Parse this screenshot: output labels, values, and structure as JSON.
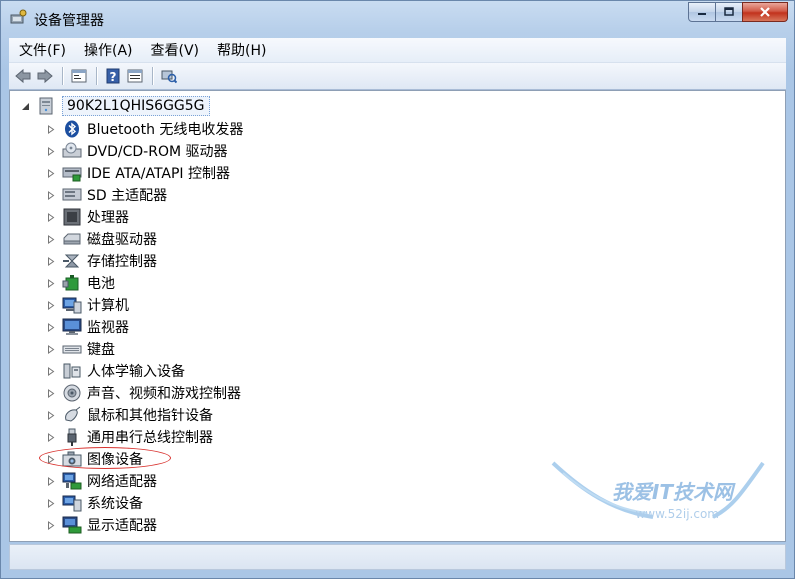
{
  "window": {
    "title": "设备管理器"
  },
  "menu": [
    "文件(F)",
    "操作(A)",
    "查看(V)",
    "帮助(H)"
  ],
  "toolbar": {
    "buttons": [
      "back-arrow-icon",
      "forward-arrow-icon",
      "properties-icon",
      "help-icon",
      "view-icon",
      "scan-hardware-icon"
    ]
  },
  "tree": {
    "root": "90K2L1QHIS6GG5G",
    "items": [
      {
        "label": "Bluetooth 无线电收发器",
        "icon": "bluetooth-icon"
      },
      {
        "label": "DVD/CD-ROM 驱动器",
        "icon": "dvd-drive-icon"
      },
      {
        "label": "IDE ATA/ATAPI 控制器",
        "icon": "ide-controller-icon"
      },
      {
        "label": "SD 主适配器",
        "icon": "sd-adapter-icon"
      },
      {
        "label": "处理器",
        "icon": "processor-icon"
      },
      {
        "label": "磁盘驱动器",
        "icon": "disk-drive-icon"
      },
      {
        "label": "存储控制器",
        "icon": "storage-controller-icon"
      },
      {
        "label": "电池",
        "icon": "battery-icon"
      },
      {
        "label": "计算机",
        "icon": "computer-icon"
      },
      {
        "label": "监视器",
        "icon": "monitor-icon"
      },
      {
        "label": "键盘",
        "icon": "keyboard-icon"
      },
      {
        "label": "人体学输入设备",
        "icon": "hid-icon"
      },
      {
        "label": "声音、视频和游戏控制器",
        "icon": "sound-icon"
      },
      {
        "label": "鼠标和其他指针设备",
        "icon": "mouse-icon"
      },
      {
        "label": "通用串行总线控制器",
        "icon": "usb-icon"
      },
      {
        "label": "图像设备",
        "icon": "imaging-device-icon"
      },
      {
        "label": "网络适配器",
        "icon": "network-adapter-icon"
      },
      {
        "label": "系统设备",
        "icon": "system-device-icon"
      },
      {
        "label": "显示适配器",
        "icon": "display-adapter-icon"
      }
    ]
  },
  "watermark": {
    "text": "我爱IT技术网",
    "url": "www.52ij.com"
  }
}
